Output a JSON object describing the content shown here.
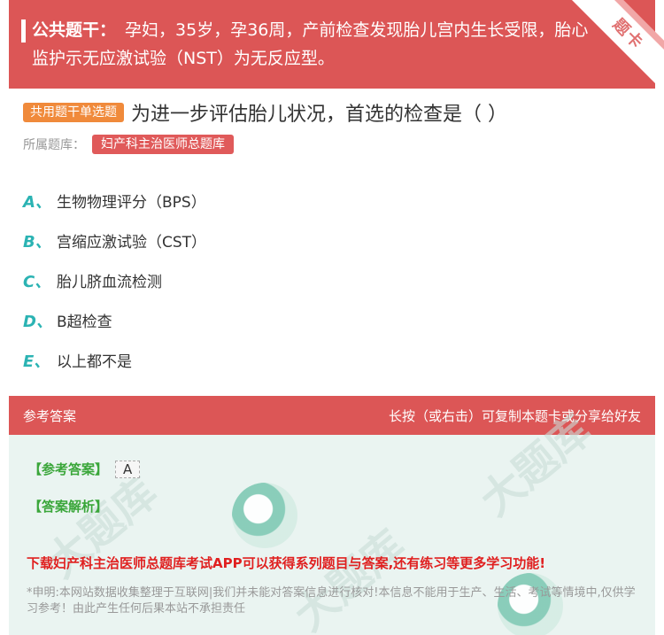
{
  "stem": {
    "label": "公共题干：",
    "text": "孕妇，35岁，孕36周，产前检查发现胎儿宫内生长受限，胎心监护示无应激试验（NST）为无反应型。",
    "corner": "题卡"
  },
  "question": {
    "type_tag": "共用题干单选题",
    "title": "为进一步评估胎儿状况，首选的检查是（ ）",
    "bank_label": "所属题库：",
    "bank_name": "妇产科主治医师总题库"
  },
  "options": [
    {
      "letter": "A、",
      "text": "生物物理评分（BPS）"
    },
    {
      "letter": "B、",
      "text": "宫缩应激试验（CST）"
    },
    {
      "letter": "C、",
      "text": "胎儿脐血流检测"
    },
    {
      "letter": "D、",
      "text": "B超检查"
    },
    {
      "letter": "E、",
      "text": "以上都不是"
    }
  ],
  "answer": {
    "header_left": "参考答案",
    "header_right": "长按（或右击）可复制本题卡或分享给好友",
    "answer_label": "【参考答案】",
    "answer_value": "A",
    "analysis_label": "【答案解析】",
    "promo": "下载妇产科主治医师总题库考试APP可以获得系列题目与答案,还有练习等更多学习功能!",
    "disclaimer": "*申明:本网站数据收集整理于互联网|我们并未能对答案信息进行核对!本信息不能用于生产、生活、考试等情境中,仅供学习参考！由此产生任何后果本站不承担责任"
  },
  "colors": {
    "header_red": "#dc5656",
    "tag_orange": "#f08a3b",
    "option_letter": "#2bb3b3",
    "answer_bg": "#eaf4f1",
    "promo_red": "#e02020"
  }
}
